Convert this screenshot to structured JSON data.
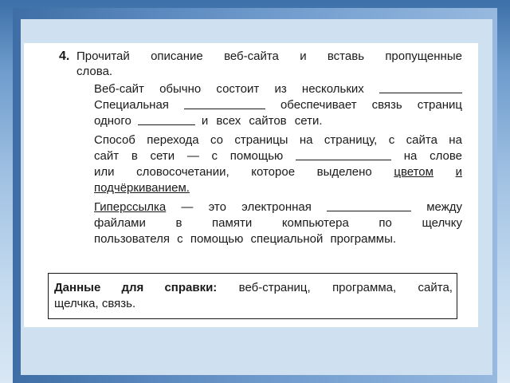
{
  "task": {
    "number": "4.",
    "intro_line1": [
      "Прочитай",
      "описание",
      "веб-сайта",
      "и",
      "вставь",
      "пропущенные"
    ],
    "intro_line2": "слова.",
    "p1_line1": [
      "Веб-сайт",
      "обычно",
      "состоит",
      "из",
      "нескольких"
    ],
    "p1_line2_a": "Специальная",
    "p1_line2_b": [
      "обеспечивает",
      "связь",
      "страниц"
    ],
    "p1_line3_a": "одного",
    "p1_line3_b": "и всех сайтов сети.",
    "p2_line1": [
      "Способ",
      "перехода",
      "со",
      "страницы",
      "на",
      "страницу,",
      "с",
      "сайта",
      "на"
    ],
    "p2_line2_a": [
      "сайт",
      "в",
      "сети",
      "—",
      "с",
      "помощью"
    ],
    "p2_line2_b": [
      "на",
      "слове"
    ],
    "p2_line3": [
      "или",
      "словосочетании,",
      "которое",
      "выделено"
    ],
    "p2_line3_ul_a": "цветом",
    "p2_line3_ul_b": "и",
    "p2_line4": "подчёркиванием.",
    "p3_line1_ul": "Гиперссылка",
    "p3_line1_a": [
      "—",
      "это",
      "электронная"
    ],
    "p3_line1_b": "между",
    "p3_line2": [
      "файлами",
      "в",
      "памяти",
      "компьютера",
      "по",
      "щелчку"
    ],
    "p3_line3": "пользователя с помощью специальной программы."
  },
  "reference": {
    "label": "Данные для справки:",
    "line1_words": [
      "веб-страниц,",
      "программа,",
      "сайта,"
    ],
    "line2": "щелчка, связь."
  }
}
